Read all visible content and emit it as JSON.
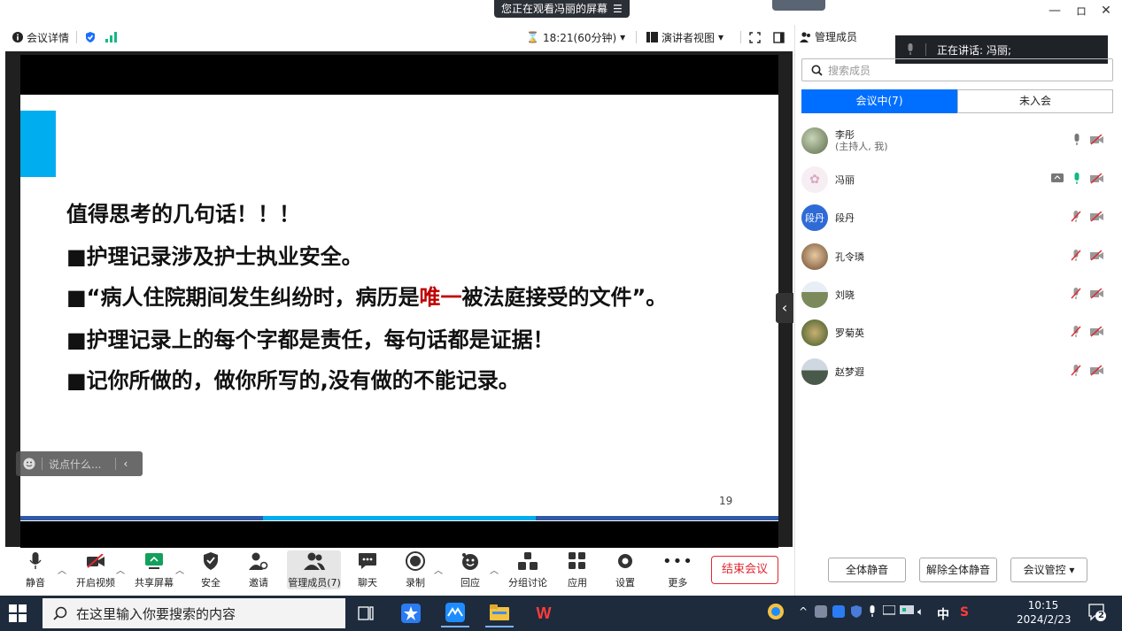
{
  "titlebar": {
    "share_status": "您正在观看冯丽的屏幕",
    "minimize": "—",
    "restore": "ロ",
    "close": "✕"
  },
  "infobar": {
    "meeting_details": "会议详情",
    "timer": "18:21(60分钟)",
    "view_mode": "演讲者视图"
  },
  "slide": {
    "heading": "值得思考的几句话！！！",
    "line1": "■护理记录涉及护士执业安全。",
    "line2_a": "■“病人住院期间发生纠纷时，病历是",
    "line2_red": "唯一",
    "line2_b": "被法庭接受的文件”。",
    "line3": "■护理记录上的每个字都是责任，每句话都是证据！",
    "line4": "■记你所做的，做你所写的,没有做的不能记录。",
    "page_number": "19"
  },
  "chat": {
    "placeholder": "说点什么..."
  },
  "panel": {
    "title": "管理成员",
    "speaking_label": "正在讲话:",
    "speaking_name": "冯丽;",
    "search_placeholder": "搜索成员",
    "tab_in_meeting": "会议中(7)",
    "tab_not_joined": "未入会",
    "members": [
      {
        "name": "李彤",
        "sub": "(主持人, 我)"
      },
      {
        "name": "冯丽",
        "sub": ""
      },
      {
        "name": "段丹",
        "sub": "",
        "avatar_text": "段丹"
      },
      {
        "name": "孔令璘",
        "sub": ""
      },
      {
        "name": "刘晓",
        "sub": ""
      },
      {
        "name": "罗菊英",
        "sub": ""
      },
      {
        "name": "赵梦遐",
        "sub": ""
      }
    ],
    "mute_all": "全体静音",
    "unmute_all": "解除全体静音",
    "meeting_control": "会议管控 ▾"
  },
  "toolbar": {
    "mute": "静音",
    "video": "开启视频",
    "share": "共享屏幕",
    "security": "安全",
    "invite": "邀请",
    "members": "管理成员(7)",
    "chat": "聊天",
    "record": "录制",
    "react": "回应",
    "breakout": "分组讨论",
    "apps": "应用",
    "settings": "设置",
    "more": "更多",
    "end_meeting": "结束会议"
  },
  "taskbar": {
    "search_placeholder": "在这里输入你要搜索的内容",
    "time": "10:15",
    "date": "2024/2/23",
    "ime": "中",
    "notif_count": "2"
  },
  "colors": {
    "accent_blue": "#006fff",
    "end_red": "#e0282f",
    "slide_accent": "#00adef",
    "highlight_red": "#c00000"
  }
}
